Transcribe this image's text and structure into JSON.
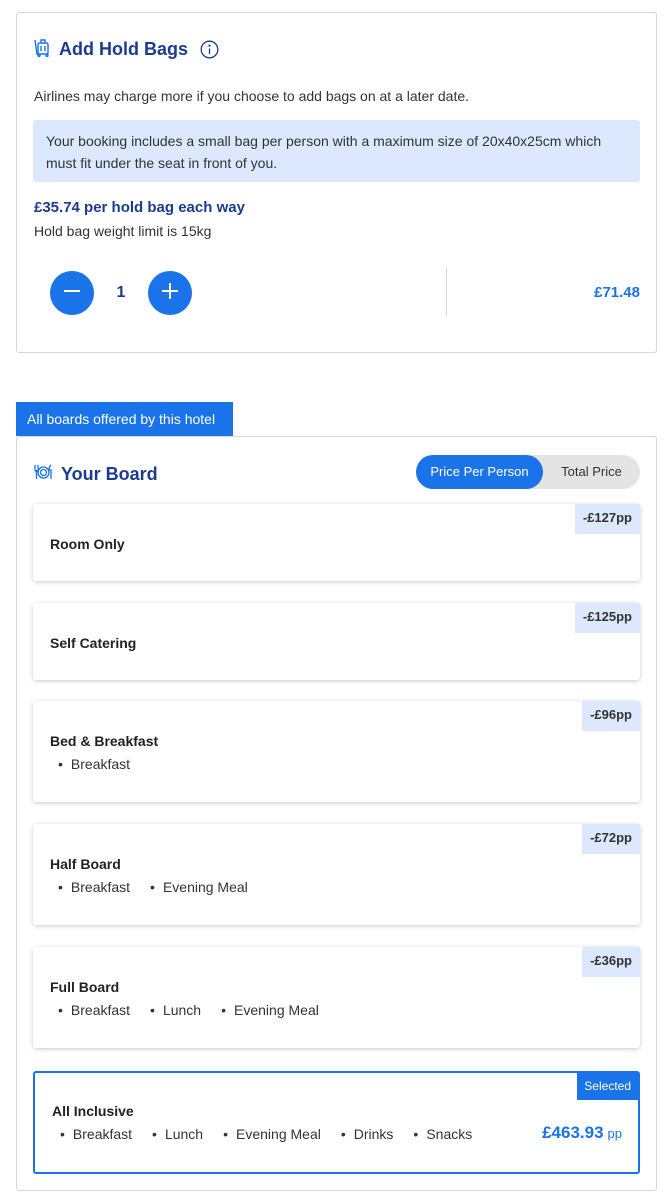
{
  "hold_bags": {
    "title": "Add Hold Bags",
    "subtitle": "Airlines may charge more if you choose to add bags on at a later date.",
    "info_text": "Your booking includes a small bag per person with a maximum size of 20x40x25cm which must fit under the seat in front of you.",
    "price_per_bag": "£35.74 per hold bag each way",
    "weight_limit": "Hold bag weight limit is 15kg",
    "quantity": "1",
    "total": "£71.48"
  },
  "boards": {
    "tag_label": "All boards offered by this hotel",
    "title": "Your Board",
    "toggle": {
      "per_person": "Price Per Person",
      "total": "Total Price",
      "selected": "per_person"
    },
    "options": [
      {
        "name": "Room Only",
        "diff": "-£127pp",
        "features": []
      },
      {
        "name": "Self Catering",
        "diff": "-£125pp",
        "features": []
      },
      {
        "name": "Bed & Breakfast",
        "diff": "-£96pp",
        "features": [
          "Breakfast"
        ]
      },
      {
        "name": "Half Board",
        "diff": "-£72pp",
        "features": [
          "Breakfast",
          "Evening Meal"
        ]
      },
      {
        "name": "Full Board",
        "diff": "-£36pp",
        "features": [
          "Breakfast",
          "Lunch",
          "Evening Meal"
        ]
      },
      {
        "name": "All Inclusive",
        "badge": "Selected",
        "price": "£463.93",
        "price_unit": "pp",
        "features": [
          "Breakfast",
          "Lunch",
          "Evening Meal",
          "Drinks",
          "Snacks"
        ]
      }
    ]
  },
  "colors": {
    "accent": "#1a73e8",
    "heading": "#1a3b8f",
    "info_bg": "#dbe8fd"
  }
}
